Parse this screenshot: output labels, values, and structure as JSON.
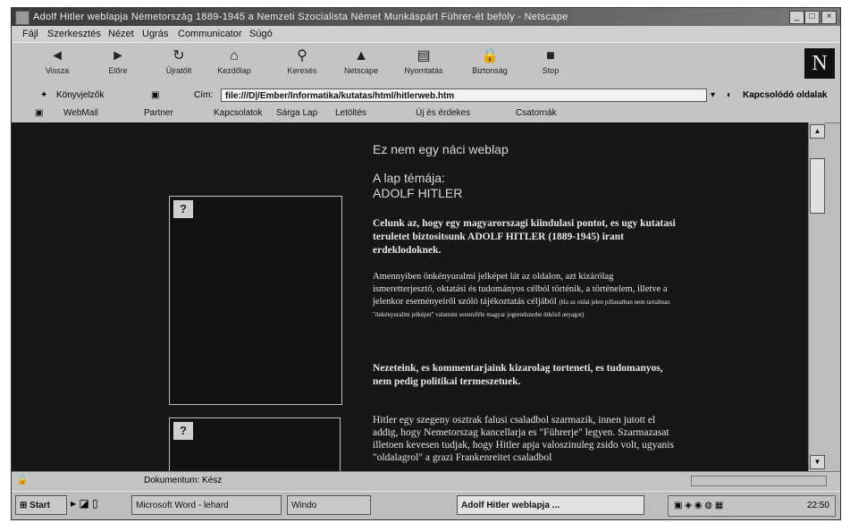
{
  "window": {
    "title": "Adolf Hitler weblapja Németország 1889-1945 a Nemzeti Szocialista Német Munkáspárt Führer-ét befoly - Netscape",
    "minimize": "_",
    "maximize": "□",
    "close": "×"
  },
  "menu": [
    "Fájl",
    "Szerkesztés",
    "Nézet",
    "Ugrás",
    "Communicator",
    "Súgó"
  ],
  "nav": {
    "back": "Vissza",
    "forward": "Előre",
    "reload": "Újratölt",
    "home": "Kezdőlap",
    "search": "Keresés",
    "netscape": "Netscape",
    "print": "Nyomtatás",
    "security": "Biztonság",
    "stop": "Stop",
    "logo": "N"
  },
  "location": {
    "bookmarks": "Könyvjelzők",
    "label": "Cím:",
    "url": "file:///D|/Ember/Informatika/kutatas/html/hitlerweb.htm",
    "related": "Kapcsolódó oldalak"
  },
  "personal": [
    "WebMail",
    "Partner",
    "Kapcsolatok",
    "Sárga Lap",
    "Letöltés",
    "Új és érdekes",
    "Csatornák"
  ],
  "page": {
    "heading": "Ez nem egy náci weblap",
    "topic_label": "A lap témája:",
    "topic": "ADOLF HITLER",
    "para1": "Celunk az, hogy egy magyarorszagi kiindulasi pontot, es ugy kutatasi teruletet biztositsunk ADOLF HITLER (1889-1945) irant erdeklodoknek.",
    "para2": "Amennyiben önkényuralmi jelképet lát az oldalon, azt kizárólag ismeretterjesztő, oktatási és tudományos célból történik, a történelem, illetve a jelenkor eseményeiről szóló tájékoztatás céljából",
    "para2_note": "(Ha az oldal jelen pillanatban nem tartalmaz \"önkényuralmi jelképet\" valamint semmiféle magyar jogrendszerbe ütköző anyagot)",
    "para3": "Nezeteink, es kommentarjaink kizarolag torteneti, es tudomanyos, nem pedig politikai termeszetuek.",
    "para4": "Hitler egy szegeny osztrak falusi csaladbol szarmazik, innen jutott el addig, hogy Nemetorszag kancellarja es \"Führerje\" legyen. Szarmazasat illetoen kevesen tudjak, hogy Hitler apja valoszinuleg zsido volt, ugyanis \"oldalagrol\" a grazi Frankenreitet csaladbol"
  },
  "status": {
    "text": "Dokumentum: Kész"
  },
  "taskbar": {
    "start": "Start",
    "items": [
      "Microsoft Word - lehard",
      "Windo",
      "Adolf Hitler weblapja ..."
    ],
    "clock": "22:50"
  }
}
